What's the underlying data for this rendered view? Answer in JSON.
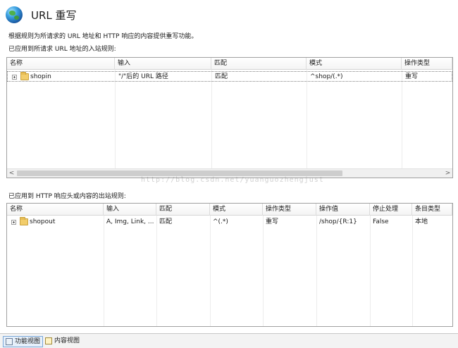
{
  "header": {
    "title": "URL 重写",
    "icon": "globe-icon"
  },
  "description": "根据规则为所请求的 URL 地址和 HTTP 响应的内容提供重写功能。",
  "inbound": {
    "section_label": "已应用到所请求 URL 地址的入站规则:",
    "columns": [
      "名称",
      "输入",
      "匹配",
      "模式",
      "操作类型"
    ],
    "rows": [
      {
        "name": "shopin",
        "input": "\"/\"后的 URL 路径",
        "match": "匹配",
        "pattern": "^shop/(.*)",
        "action": "重写"
      }
    ],
    "scroll_left": "<",
    "scroll_right": ">"
  },
  "outbound": {
    "section_label": "已应用到 HTTP 响应头或内容的出站规则:",
    "columns": [
      "名称",
      "输入",
      "匹配",
      "模式",
      "操作类型",
      "操作值",
      "停止处理",
      "条目类型"
    ],
    "rows": [
      {
        "name": "shopout",
        "input": "A, Img, Link, ...",
        "match": "匹配",
        "pattern": "^(.*)",
        "action": "重写",
        "value": "/shop/{R:1}",
        "stop": "False",
        "entry": "本地"
      }
    ]
  },
  "watermark": "http://blog.csdn.net/yuanguozhengjust",
  "bottom_tabs": {
    "features": "功能视图",
    "content": "内容视图"
  }
}
